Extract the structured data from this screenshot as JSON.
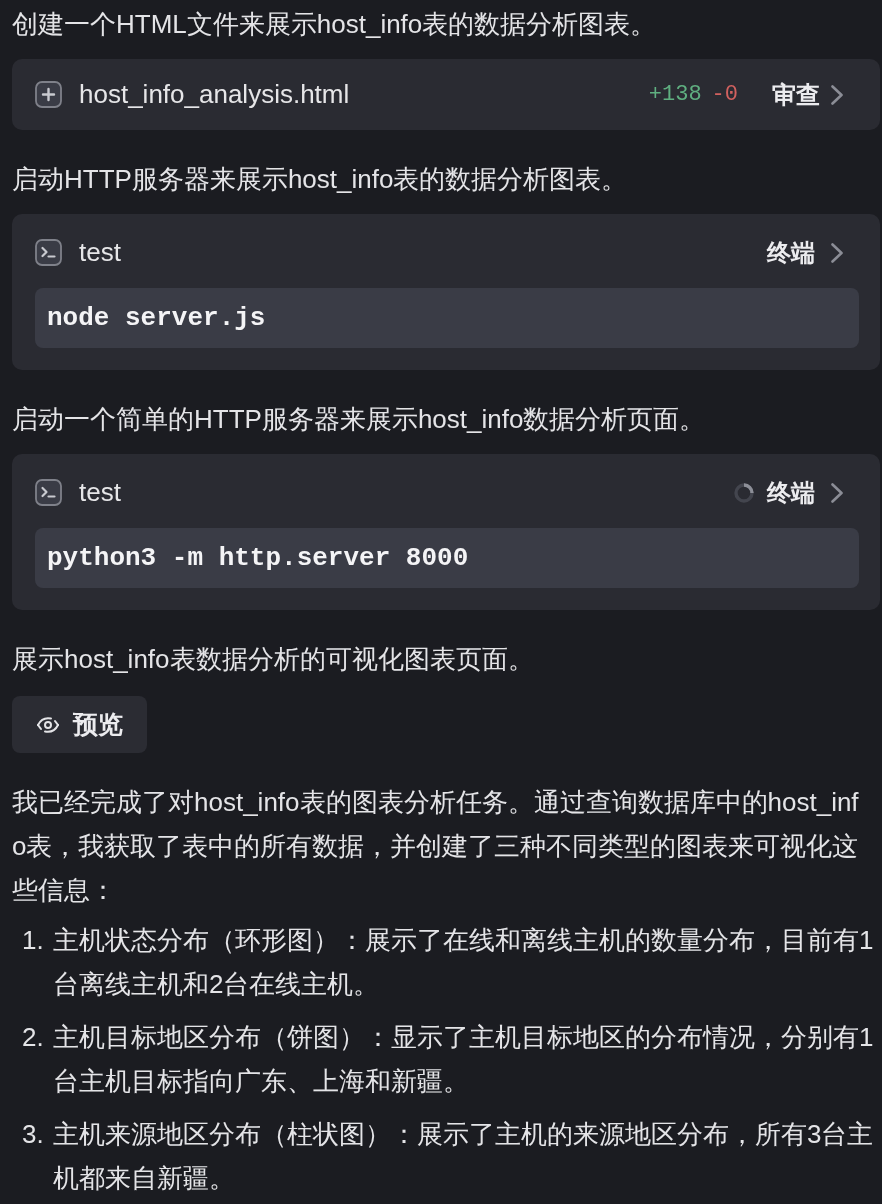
{
  "messages": [
    {
      "kind": "text",
      "text": "创建一个HTML文件来展示host_info表的数据分析图表。"
    },
    {
      "kind": "file",
      "name": "host_info_analysis.html",
      "added": "+138",
      "removed": "-0",
      "action": "审查"
    },
    {
      "kind": "text",
      "text": "启动HTTP服务器来展示host_info表的数据分析图表。"
    },
    {
      "kind": "terminal",
      "title": "test",
      "running": false,
      "action": "终端",
      "command": "node server.js"
    },
    {
      "kind": "text",
      "text": "启动一个简单的HTTP服务器来展示host_info数据分析页面。"
    },
    {
      "kind": "terminal",
      "title": "test",
      "running": true,
      "action": "终端",
      "command": "python3 -m http.server 8000"
    },
    {
      "kind": "text",
      "text": "展示host_info表数据分析的可视化图表页面。"
    },
    {
      "kind": "preview",
      "label": "预览"
    },
    {
      "kind": "text",
      "text": "我已经完成了对host_info表的图表分析任务。通过查询数据库中的host_info表，我获取了表中的所有数据，并创建了三种不同类型的图表来可视化这些信息："
    },
    {
      "kind": "list",
      "items": [
        {
          "number": "1.",
          "text": "主机状态分布（环形图）：展示了在线和离线主机的数量分布，目前有1台离线主机和2台在线主机。"
        },
        {
          "number": "2.",
          "text": "主机目标地区分布（饼图）：显示了主机目标地区的分布情况，分别有1台主机目标指向广东、上海和新疆。"
        },
        {
          "number": "3.",
          "text": "主机来源地区分布（柱状图）：展示了主机的来源地区分布，所有3台主机都来自新疆。"
        }
      ]
    }
  ]
}
